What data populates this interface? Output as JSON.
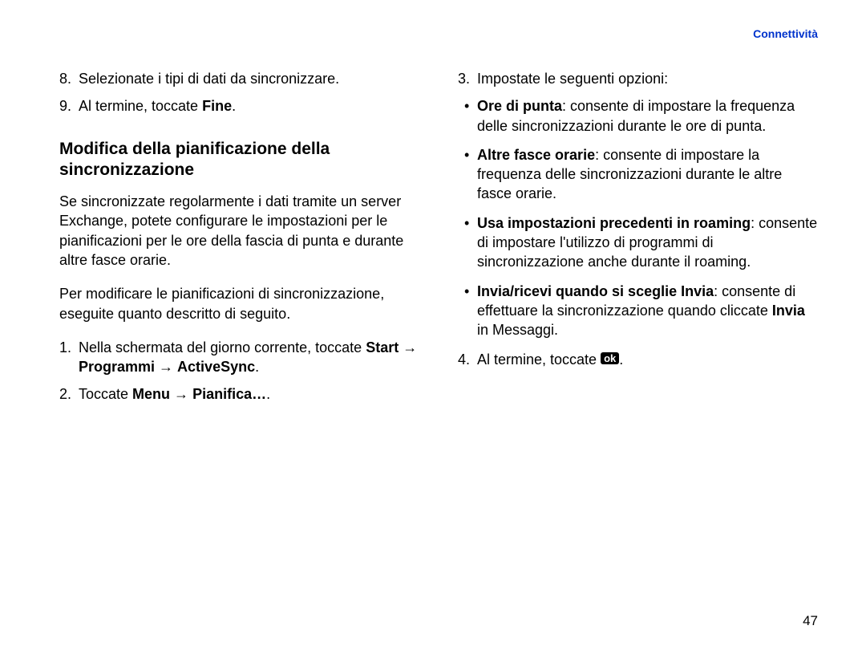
{
  "header": {
    "link": "Connettività"
  },
  "left": {
    "item8_num": "8.",
    "item8_text": "Selezionate i tipi di dati da sincronizzare.",
    "item9_num": "9.",
    "item9_pre": "Al termine, toccate ",
    "item9_bold": "Fine",
    "item9_post": ".",
    "heading": "Modifica della pianificazione della sincronizzazione",
    "para1": "Se sincronizzate regolarmente i dati tramite un server Exchange, potete configurare le impostazioni per le pianificazioni per le ore della fascia di punta e durante altre fasce orarie.",
    "para2": "Per modificare le pianificazioni di sincronizzazione, eseguite quanto descritto di seguito.",
    "item1_num": "1.",
    "item1_pre": "Nella schermata del giorno corrente, toccate ",
    "item1_b1": "Start",
    "item1_arrow1": " → ",
    "item1_b2": "Programmi",
    "item1_arrow2": " → ",
    "item1_b3": "ActiveSync",
    "item1_post": ".",
    "item2_num": "2.",
    "item2_pre": "Toccate ",
    "item2_b1": "Menu",
    "item2_arrow": " → ",
    "item2_b2": "Pianifica…",
    "item2_post": "."
  },
  "right": {
    "item3_num": "3.",
    "item3_text": "Impostate le seguenti opzioni:",
    "b1_label": "Ore di punta",
    "b1_text": ": consente di impostare la frequenza delle sincronizzazioni durante le ore di punta.",
    "b2_label": "Altre fasce orarie",
    "b2_text": ": consente di impostare la frequenza delle sincronizzazioni durante le altre fasce orarie.",
    "b3_label": "Usa impostazioni precedenti in roaming",
    "b3_text": ": consente di impostare l'utilizzo di programmi di sincronizzazione anche durante il roaming.",
    "b4_label": "Invia/ricevi quando si sceglie Invia",
    "b4_text1": ": consente di effettuare la sincronizzazione quando cliccate ",
    "b4_bold2": "Invia",
    "b4_text2": " in Messaggi.",
    "item4_num": "4.",
    "item4_pre": "Al termine, toccate ",
    "item4_badge": "ok",
    "item4_post": "."
  },
  "page_number": "47"
}
